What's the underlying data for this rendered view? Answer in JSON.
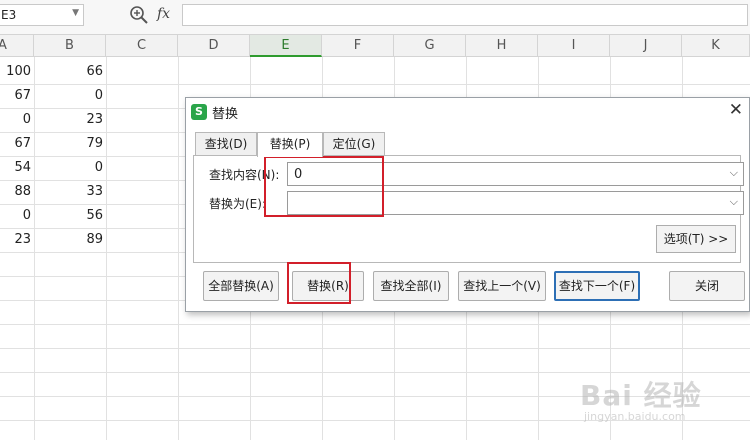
{
  "formula_bar": {
    "name_box": "E3",
    "fx_label": "fx",
    "formula": ""
  },
  "grid": {
    "columns": [
      "A",
      "B",
      "C",
      "D",
      "E",
      "F",
      "G",
      "H",
      "I",
      "J",
      "K"
    ],
    "active_column": "E",
    "rows": [
      {
        "a": "100",
        "b": "66"
      },
      {
        "a": "67",
        "b": "0"
      },
      {
        "a": "0",
        "b": "23"
      },
      {
        "a": "67",
        "b": "79"
      },
      {
        "a": "54",
        "b": "0"
      },
      {
        "a": "88",
        "b": "33"
      },
      {
        "a": "0",
        "b": "56"
      },
      {
        "a": "23",
        "b": "89"
      }
    ]
  },
  "dialog": {
    "title": "替换",
    "icon_letter": "S",
    "tabs": [
      {
        "label": "查找(D)",
        "active": false
      },
      {
        "label": "替换(P)",
        "active": true
      },
      {
        "label": "定位(G)",
        "active": false
      }
    ],
    "find_label": "查找内容(N):",
    "find_value": "0",
    "replace_label": "替换为(E):",
    "replace_value": "",
    "options_label": "选项(T) >>",
    "buttons": {
      "replace_all": "全部替换(A)",
      "replace": "替换(R)",
      "find_all": "查找全部(I)",
      "find_prev": "查找上一个(V)",
      "find_next": "查找下一个(F)",
      "close": "关闭"
    }
  },
  "watermark": {
    "main": "Bai 经验",
    "sub": "jingyan.baidu.com"
  },
  "colors": {
    "annotation_red": "#d21f2a",
    "accent_green": "#2aa54a",
    "focus_blue": "#2d6fb5"
  }
}
